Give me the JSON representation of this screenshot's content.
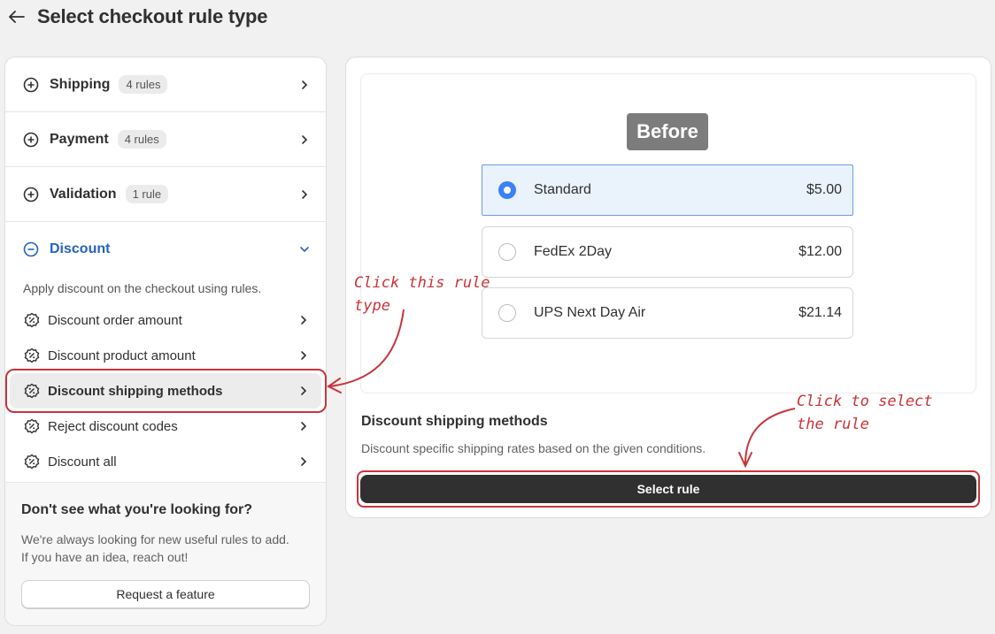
{
  "header": {
    "title": "Select checkout rule type",
    "back_icon": "arrow-left-icon"
  },
  "categories": [
    {
      "label": "Shipping",
      "badge": "4 rules",
      "icon": "plus-circle-icon"
    },
    {
      "label": "Payment",
      "badge": "4 rules",
      "icon": "plus-circle-icon"
    },
    {
      "label": "Validation",
      "badge": "1 rule",
      "icon": "plus-circle-icon"
    }
  ],
  "discount": {
    "label": "Discount",
    "icon": "minus-circle-icon",
    "description": "Apply discount on the checkout using rules.",
    "items": [
      {
        "label": "Discount order amount",
        "icon": "discount-icon"
      },
      {
        "label": "Discount product amount",
        "icon": "discount-icon"
      },
      {
        "label": "Discount shipping methods",
        "icon": "discount-icon",
        "selected": true
      },
      {
        "label": "Reject discount codes",
        "icon": "discount-icon"
      },
      {
        "label": "Discount all",
        "icon": "discount-icon"
      }
    ]
  },
  "footer": {
    "title": "Don't see what you're looking for?",
    "text": "We're always looking for new useful rules to add. If you have an idea, reach out!",
    "button": "Request a feature"
  },
  "preview": {
    "badge": "Before",
    "options": [
      {
        "name": "Standard",
        "price": "$5.00",
        "selected": true
      },
      {
        "name": "FedEx 2Day",
        "price": "$12.00",
        "selected": false
      },
      {
        "name": "UPS Next Day Air",
        "price": "$21.14",
        "selected": false
      }
    ]
  },
  "selected_rule": {
    "title": "Discount shipping methods",
    "description": "Discount specific shipping rates based on the given conditions.",
    "button": "Select rule"
  },
  "annotations": {
    "left_note_line1": "Click this rule",
    "left_note_line2": "type",
    "right_note_line1": "Click to select",
    "right_note_line2": "the rule"
  },
  "colors": {
    "annotation": "#c8343a",
    "accent": "#2463bc",
    "radio_selected": "#3b82f6"
  }
}
